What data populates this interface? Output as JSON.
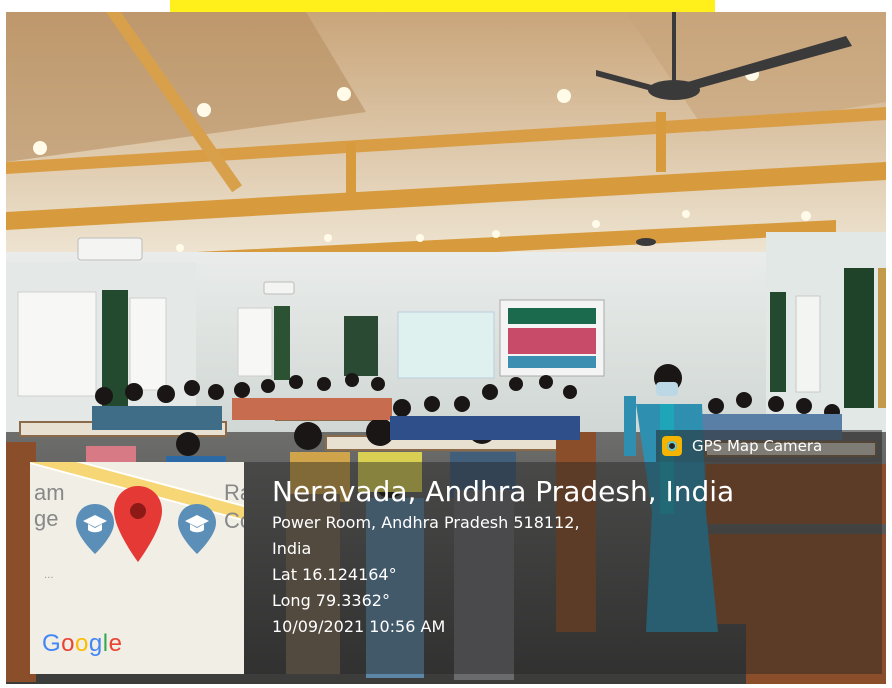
{
  "banner": {
    "text": ""
  },
  "overlay": {
    "app_name": "GPS Map Camera",
    "location_title": "Neravada, Andhra Pradesh, India",
    "address_line1": "Power Room, Andhra Pradesh 518112,",
    "address_line2": "India",
    "latitude": "Lat 16.124164°",
    "longitude": "Long 79.3362°",
    "timestamp": "10/09/2021 10:56 AM"
  },
  "map": {
    "left_label_1": "am",
    "left_label_2": "ge",
    "right_label_1": "Ra",
    "right_label_2": "Co",
    "dots": "...",
    "logo": "Google",
    "logo_letters": [
      "G",
      "o",
      "o",
      "g",
      "l",
      "e"
    ],
    "pin_color": "#e53935",
    "edu_pin_color": "#5b8fb8"
  },
  "colors": {
    "banner": "#ffef1a",
    "ceiling": "#ece4d2",
    "wood_trim": "#d79a3c",
    "curtain": "#234a2e"
  }
}
